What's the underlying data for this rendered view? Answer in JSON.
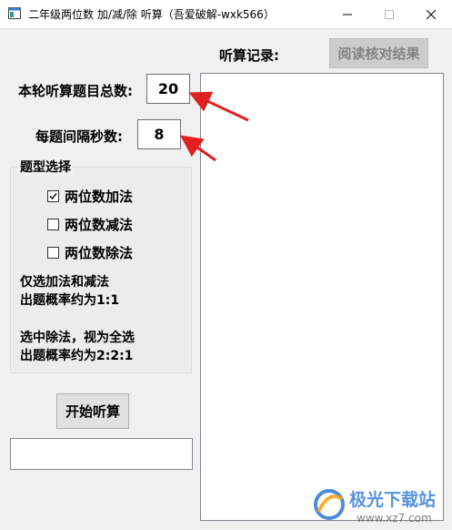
{
  "window": {
    "title": "二年级两位数 加/减/除 听算（吾爱破解-wxk566）",
    "minimize_glyph": "—",
    "maximize_glyph": "☐",
    "close_glyph": "✕"
  },
  "form": {
    "total_label": "本轮听算题目总数:",
    "total_value": "20",
    "interval_label": "每题间隔秒数:",
    "interval_value": "8"
  },
  "question_types": {
    "title": "题型选择",
    "options": [
      {
        "label": "两位数加法",
        "checked": true
      },
      {
        "label": "两位数减法",
        "checked": false
      },
      {
        "label": "两位数除法",
        "checked": false
      }
    ],
    "note1_line1": "仅选加法和减法",
    "note1_line2": "出题概率约为1:1",
    "note2_line1": "选中除法，视为全选",
    "note2_line2": "出题概率约为2:2:1"
  },
  "buttons": {
    "start": "开始听算",
    "check": "阅读核对结果"
  },
  "record": {
    "label": "听算记录:"
  },
  "status_value": "",
  "watermark": {
    "brand": "极光下载站",
    "url": "www.xz7.com"
  },
  "colors": {
    "arrow": "#e02020",
    "brand_blue": "#1f6fd1",
    "brand_orange": "#f5a012"
  },
  "icons": {
    "app": "app-window-icon",
    "checkbox_checked": "✓"
  }
}
